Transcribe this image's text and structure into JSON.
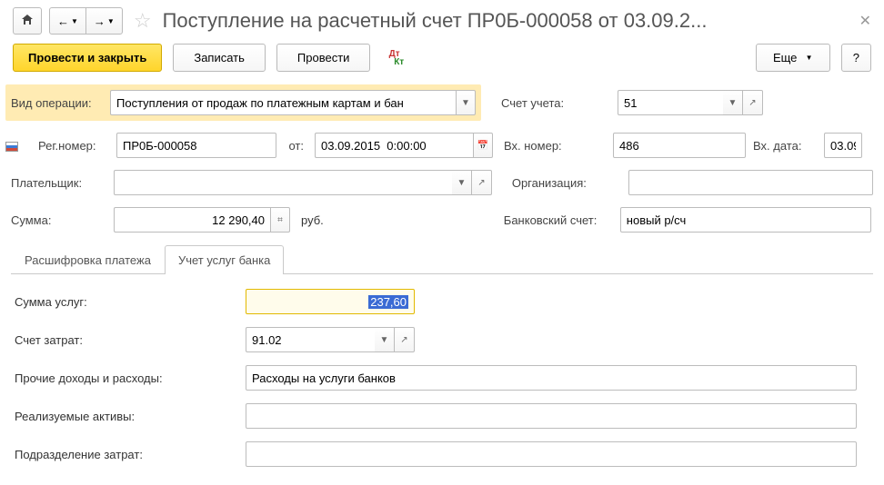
{
  "title": "Поступление на расчетный счет ПР0Б-000058 от 03.09.2...",
  "toolbar": {
    "postClose": "Провести и закрыть",
    "save": "Записать",
    "post": "Провести",
    "more": "Еще",
    "help": "?"
  },
  "fields": {
    "opType": {
      "label": "Вид операции:",
      "value": "Поступления от продаж по платежным картам и бан"
    },
    "account": {
      "label": "Счет учета:",
      "value": "51"
    },
    "regNo": {
      "label": "Рег.номер:",
      "value": "ПР0Б-000058"
    },
    "from": {
      "label": "от:",
      "value": "03.09.2015  0:00:00"
    },
    "inNo": {
      "label": "Вх. номер:",
      "value": "486"
    },
    "inDate": {
      "label": "Вх. дата:",
      "value": "03.09."
    },
    "payer": {
      "label": "Плательщик:",
      "value": ""
    },
    "org": {
      "label": "Организация:",
      "value": ""
    },
    "sum": {
      "label": "Сумма:",
      "value": "12 290,40",
      "unit": "руб."
    },
    "bank": {
      "label": "Банковский счет:",
      "value": "новый р/сч"
    }
  },
  "tabs": {
    "t1": "Расшифровка платежа",
    "t2": "Учет услуг банка"
  },
  "inner": {
    "serviceSum": {
      "label": "Сумма услуг:",
      "value": "237,60"
    },
    "costAcc": {
      "label": "Счет затрат:",
      "value": "91.02"
    },
    "other": {
      "label": "Прочие доходы и расходы:",
      "value": "Расходы на услуги банков"
    },
    "assets": {
      "label": "Реализуемые активы:",
      "value": ""
    },
    "dept": {
      "label": "Подразделение затрат:",
      "value": ""
    }
  }
}
